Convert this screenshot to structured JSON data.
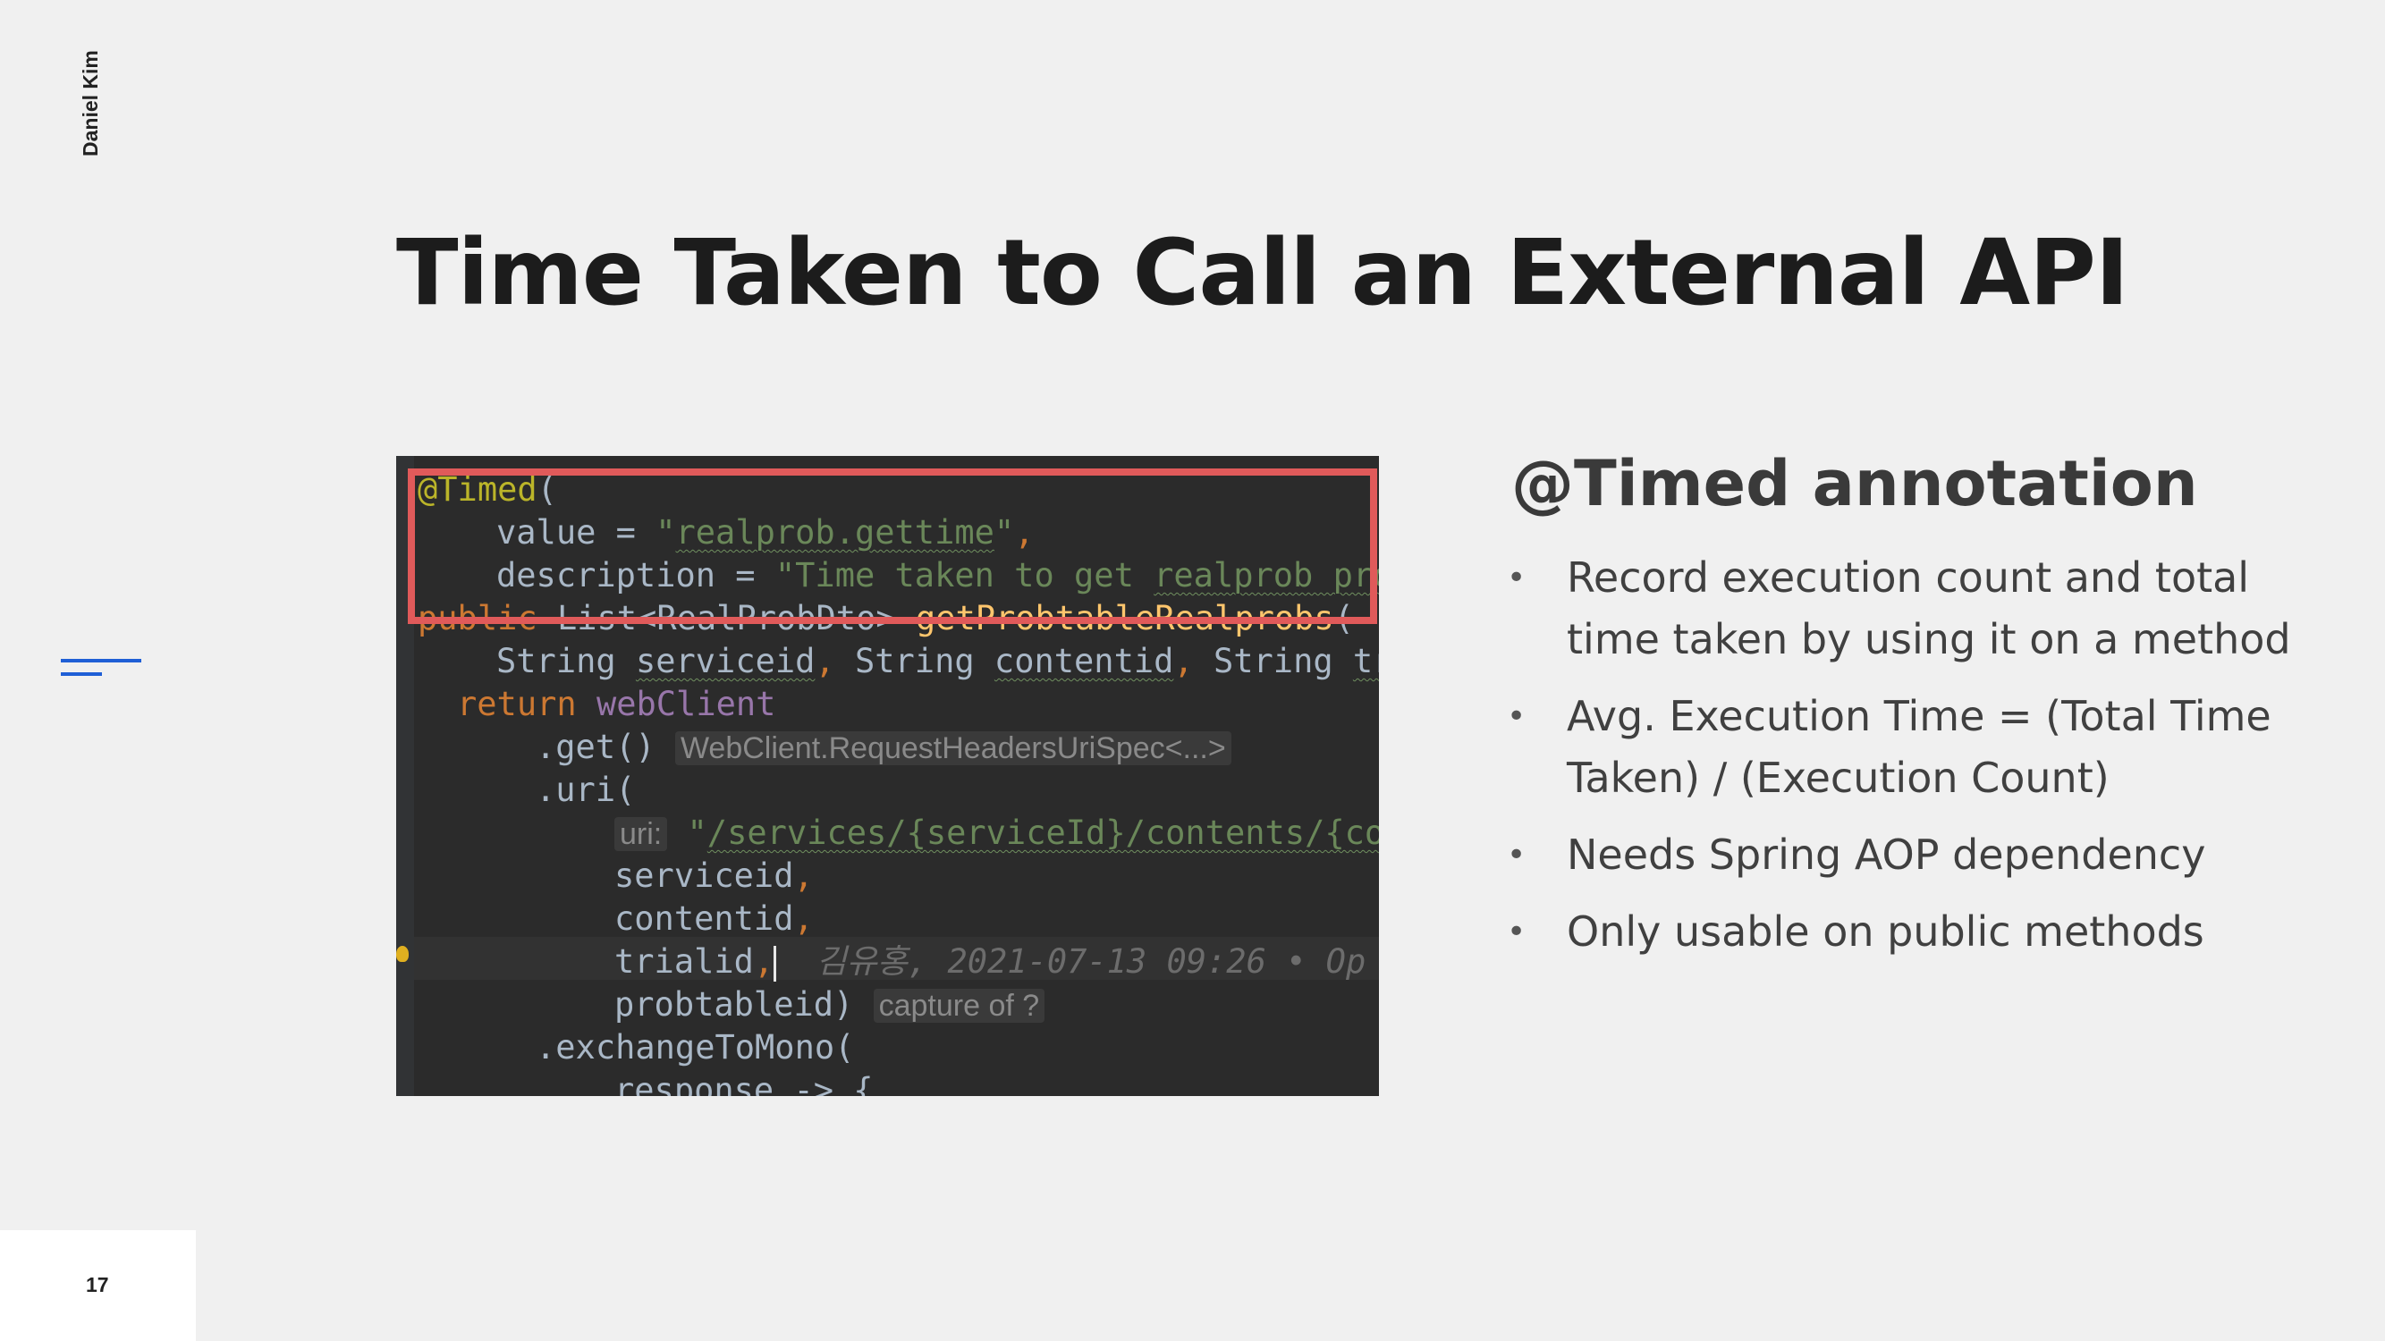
{
  "author": "Daniel Kim",
  "title": "Time Taken to Call an External API",
  "page_number": "17",
  "code": {
    "l1_ann": "@Timed",
    "l1_paren": "(",
    "l2_key": "value = ",
    "l2_q1": "\"",
    "l2_str": "realprob.gettime",
    "l2_q2": "\"",
    "l2_comma": ",",
    "l3_key": "description = ",
    "l3_str": "\"Time taken to get ",
    "l3_str_ul": "realprob pro",
    "l4_kw": "public ",
    "l4_type": "List<RealProbDto> ",
    "l4_fn": "getProbtableRealprobs",
    "l4_paren": "(",
    "l5_t1": "String ",
    "l5_p1": "serviceid",
    "l5_c1": ", ",
    "l5_t2": "String ",
    "l5_p2": "contentid",
    "l5_c2": ", ",
    "l5_t3": "String ",
    "l5_p3": "tr",
    "l6_kw": "return ",
    "l6_fld": "webClient",
    "l7_code": ".get() ",
    "l7_hint": "WebClient.RequestHeadersUriSpec<...>",
    "l8_code": ".uri(",
    "l9_hint": "uri:",
    "l9_q": " \"",
    "l9_str": "/services/{serviceId}/contents/{con",
    "l10_code": "serviceid",
    "l10_comma": ",",
    "l11_code": "contentid",
    "l11_comma": ",",
    "l12_code": "trialid",
    "l12_comma": ",",
    "l12_blame": "  김유홍, 2021-07-13 09:26 • Op",
    "l13_code": "probtableid) ",
    "l13_hint": "capture of ?",
    "l14_code": ".exchangeToMono(",
    "l15_code": "response -> {"
  },
  "subheading": "@Timed annotation",
  "bullets": [
    {
      "dot": "•",
      "text": "Record execution count and total time taken by using it on a method"
    },
    {
      "dot": "•",
      "text": "Avg. Execution Time = (Total Time Taken) / (Execution Count)"
    },
    {
      "dot": "•",
      "text": "Needs Spring AOP dependency"
    },
    {
      "dot": "•",
      "text": "Only usable on public methods"
    }
  ]
}
